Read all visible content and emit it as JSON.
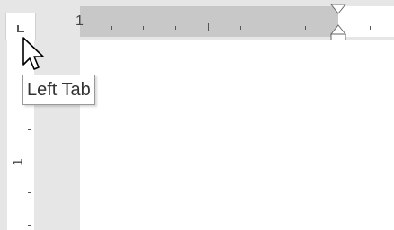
{
  "ruler": {
    "horizontal_label": "1",
    "vertical_label": "1"
  },
  "tab_selector": {
    "tooltip": "Left Tab",
    "icon": "left-tab-icon"
  },
  "colors": {
    "margin_gray": "#c8c8c8",
    "ruler_bg": "#e6e6e6",
    "page": "#ffffff"
  }
}
